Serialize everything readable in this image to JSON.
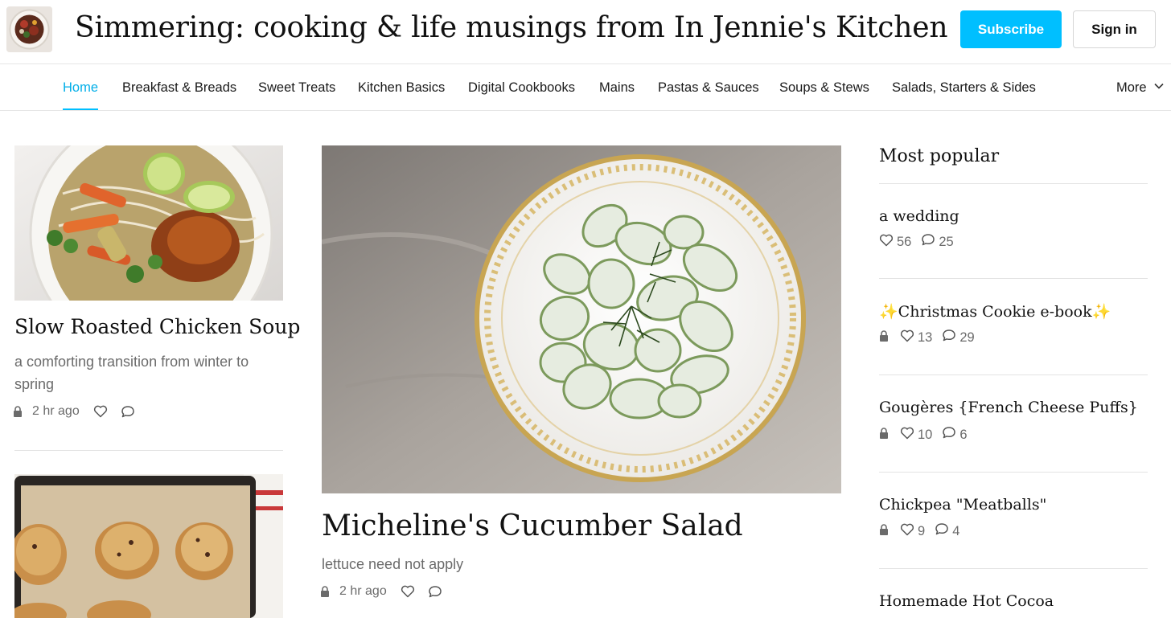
{
  "header": {
    "site_title": "Simmering: cooking & life musings from In Jennie's Kitchen",
    "subscribe_label": "Subscribe",
    "signin_label": "Sign in",
    "accent_color": "#00bfff"
  },
  "nav": {
    "items": [
      {
        "label": "Home",
        "active": true
      },
      {
        "label": "Breakfast & Breads"
      },
      {
        "label": "Sweet Treats"
      },
      {
        "label": "Kitchen Basics"
      },
      {
        "label": "Digital Cookbooks"
      },
      {
        "label": "Mains"
      },
      {
        "label": "Pastas & Sauces"
      },
      {
        "label": "Soups & Stews"
      },
      {
        "label": "Salads, Starters & Sides"
      }
    ],
    "more_label": "More"
  },
  "left_posts": [
    {
      "title": "Slow Roasted Chicken Soup",
      "subtitle": "a comforting transition from winter to spring",
      "time": "2 hr ago",
      "image": "chicken-soup-photo"
    },
    {
      "image": "scones-on-sheet-pan-photo"
    }
  ],
  "featured": {
    "title": "Micheline's Cucumber Salad",
    "subtitle": "lettuce need not apply",
    "time": "2 hr ago",
    "image": "cucumber-salad-photo"
  },
  "sidebar": {
    "heading": "Most popular",
    "posts": [
      {
        "title": "a wedding",
        "locked": false,
        "likes": "56",
        "comments": "25"
      },
      {
        "title": "Christmas Cookie e-book",
        "sparkles": true,
        "locked": true,
        "likes": "13",
        "comments": "29"
      },
      {
        "title": "Gougères {French Cheese Puffs}",
        "locked": true,
        "likes": "10",
        "comments": "6"
      },
      {
        "title": "Chickpea \"Meatballs\"",
        "locked": true,
        "likes": "9",
        "comments": "4"
      },
      {
        "title": "Homemade Hot Cocoa"
      }
    ]
  },
  "sparkle_glyph": "✨"
}
